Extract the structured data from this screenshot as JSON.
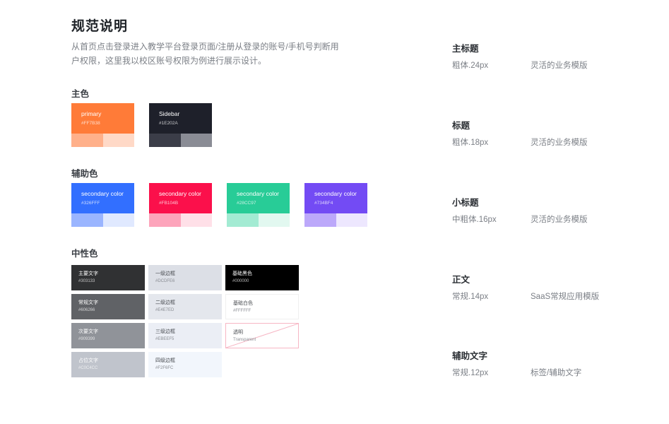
{
  "page": {
    "title": "规范说明",
    "description": "从首页点击登录进入教学平台登录页面/注册从登录的账号/手机号判断用户权限，这里我以校区账号权限为例进行展示设计。"
  },
  "primary": {
    "label": "主色",
    "swatches": [
      {
        "name": "primary",
        "hex": "#FF7B38",
        "color": "#FF7B38",
        "tint1": "#FFB08A",
        "tint2": "#FFD9C7"
      },
      {
        "name": "Sidebar",
        "hex": "#1E202A",
        "color": "#1E202A",
        "tint1": "#3B3D48",
        "tint2": "#8A8C95"
      }
    ]
  },
  "secondary": {
    "label": "辅助色",
    "swatches": [
      {
        "name": "secondary color",
        "hex": "#326FFF",
        "color": "#326FFF",
        "tint1": "#9AB5FF",
        "tint2": "#E0E9FF"
      },
      {
        "name": "secondary color",
        "hex": "#FB104B",
        "color": "#FB104B",
        "tint1": "#FDA4BB",
        "tint2": "#FFE0E8"
      },
      {
        "name": "secondary color",
        "hex": "#28CC97",
        "color": "#28CC97",
        "tint1": "#A3EBD3",
        "tint2": "#E2F8F0"
      },
      {
        "name": "secondary color",
        "hex": "#734BF4",
        "color": "#734BF4",
        "tint1": "#BCA8FA",
        "tint2": "#EDE7FE"
      }
    ]
  },
  "neutral": {
    "label": "中性色",
    "text_colors": [
      {
        "name": "主要文字",
        "hex": "#303133",
        "color": "#303133"
      },
      {
        "name": "常规文字",
        "hex": "#606266",
        "color": "#606266"
      },
      {
        "name": "次要文字",
        "hex": "#909399",
        "color": "#909399"
      },
      {
        "name": "占位文字",
        "hex": "#C0C4CC",
        "color": "#C0C4CC"
      }
    ],
    "border_colors": [
      {
        "name": "一级边框",
        "hex": "#DCDFE6",
        "color": "#DCDFE6"
      },
      {
        "name": "二级边框",
        "hex": "#E4E7ED",
        "color": "#E4E7ED"
      },
      {
        "name": "三级边框",
        "hex": "#EBEEF5",
        "color": "#EBEEF5"
      },
      {
        "name": "四级边框",
        "hex": "#F2F6FC",
        "color": "#F2F6FC"
      }
    ],
    "base_colors": [
      {
        "name": "基础黑色",
        "hex": "#000000",
        "color": "#000000"
      },
      {
        "name": "基础白色",
        "hex": "#FFFFFF",
        "color": "#FFFFFF"
      },
      {
        "name": "透明",
        "hex": "Transparent",
        "color": "transparent"
      }
    ]
  },
  "typography": [
    {
      "title": "主标题",
      "spec": "粗体.24px",
      "example": "灵活的业务模版"
    },
    {
      "title": "标题",
      "spec": "粗体.18px",
      "example": "灵活的业务模版"
    },
    {
      "title": "小标题",
      "spec": "中粗体.16px",
      "example": "灵活的业务模版"
    },
    {
      "title": "正文",
      "spec": "常规.14px",
      "example": "SaaS常规应用模版"
    },
    {
      "title": "辅助文字",
      "spec": "常规.12px",
      "example": "标签/辅助文字"
    }
  ]
}
